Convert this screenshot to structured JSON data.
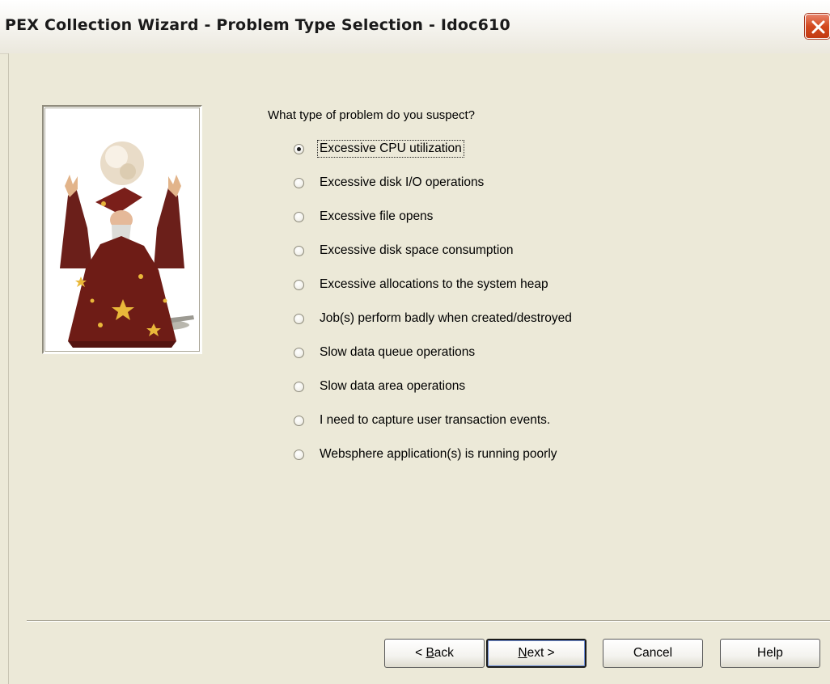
{
  "window": {
    "title": "PEX Collection Wizard - Problem Type Selection - Idoc610",
    "close_icon": "close-icon"
  },
  "wizard_image": "wizard-illustration",
  "question": "What type of problem do you suspect?",
  "options": [
    {
      "label": "Excessive CPU utilization",
      "checked": true
    },
    {
      "label": "Excessive disk I/O operations",
      "checked": false
    },
    {
      "label": "Excessive file opens",
      "checked": false
    },
    {
      "label": "Excessive disk space consumption",
      "checked": false
    },
    {
      "label": "Excessive allocations to the system heap",
      "checked": false
    },
    {
      "label": "Job(s) perform badly when created/destroyed",
      "checked": false
    },
    {
      "label": "Slow data queue operations",
      "checked": false
    },
    {
      "label": "Slow data area operations",
      "checked": false
    },
    {
      "label": "I need to capture user transaction events.",
      "checked": false
    },
    {
      "label": "Websphere application(s) is running poorly",
      "checked": false
    }
  ],
  "buttons": {
    "back": {
      "pre": "< ",
      "accel": "B",
      "post": "ack"
    },
    "next": {
      "pre": "",
      "accel": "N",
      "post": "ext >"
    },
    "cancel": "Cancel",
    "help": "Help"
  }
}
